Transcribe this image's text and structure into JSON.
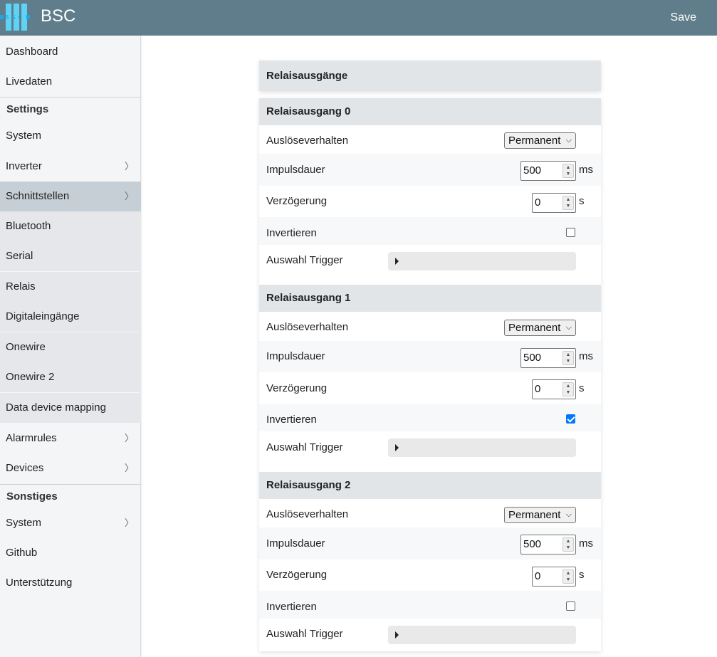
{
  "header": {
    "title": "BSC",
    "logo_text": "BSC",
    "save_label": "Save"
  },
  "sidebar": {
    "items": [
      {
        "label": "Dashboard"
      },
      {
        "label": "Livedaten"
      }
    ],
    "settings_header": "Settings",
    "settings_items": [
      {
        "label": "System"
      },
      {
        "label": "Inverter",
        "chevron": "〉"
      },
      {
        "label": "Schnittstellen",
        "chevron": "〉"
      },
      {
        "label": "Bluetooth"
      },
      {
        "label": "Serial"
      },
      {
        "label": "Relais"
      },
      {
        "label": "Digitaleingänge"
      },
      {
        "label": "Onewire"
      },
      {
        "label": "Onewire 2"
      },
      {
        "label": "Data device mapping"
      },
      {
        "label": "Alarmrules",
        "chevron": "〉"
      },
      {
        "label": "Devices",
        "chevron": "〉"
      }
    ],
    "other_header": "Sonstiges",
    "other_items": [
      {
        "label": "System",
        "chevron": "〉"
      },
      {
        "label": "Github"
      },
      {
        "label": "Unterstützung"
      }
    ]
  },
  "main": {
    "panel_title": "Relaisausgänge",
    "labels": {
      "mode": "Auslöseverhalten",
      "pulse": "Impulsdauer",
      "delay": "Verzögerung",
      "invert": "Invertieren",
      "trigger": "Auswahl Trigger",
      "unit_ms": "ms",
      "unit_s": "s"
    },
    "relays": [
      {
        "title": "Relaisausgang 0",
        "mode": "Permanent",
        "pulse": "500",
        "delay": "0",
        "inverted": false
      },
      {
        "title": "Relaisausgang 1",
        "mode": "Permanent",
        "pulse": "500",
        "delay": "0",
        "inverted": true
      },
      {
        "title": "Relaisausgang 2",
        "mode": "Permanent",
        "pulse": "500",
        "delay": "0",
        "inverted": false
      }
    ]
  },
  "colors": {
    "header_bg": "#607d8b",
    "checkbox_checked": "#0075ff",
    "active_nav": "#c6cfd5"
  }
}
